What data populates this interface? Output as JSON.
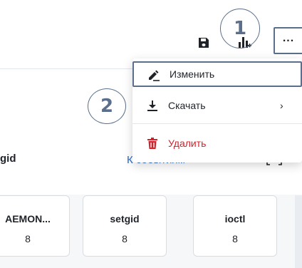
{
  "toolbar": {
    "more_label": "...",
    "save_icon": "save-icon",
    "chart_icon": "bar-chart-add-icon"
  },
  "callouts": [
    "1",
    "2"
  ],
  "menu": {
    "items": [
      {
        "label": "Изменить",
        "icon": "pencil-icon"
      },
      {
        "label": "Скачать",
        "icon": "download-icon",
        "submenu": "›"
      },
      {
        "label": "Удалить",
        "icon": "trash-icon",
        "color": "#d4202a"
      }
    ]
  },
  "panel": {
    "title": "gid",
    "link": "К событиям"
  },
  "cards": [
    {
      "name": "AEMON...",
      "value": "8"
    },
    {
      "name": "setgid",
      "value": "8"
    },
    {
      "name": "ioctl",
      "value": "8"
    }
  ]
}
